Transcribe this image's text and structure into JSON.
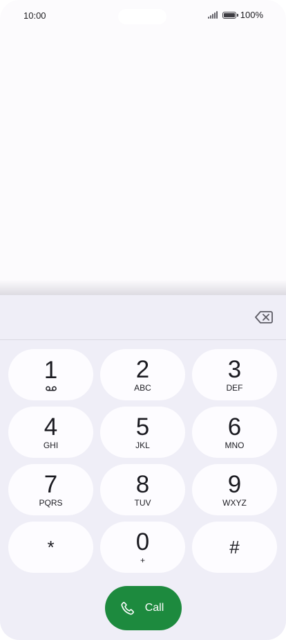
{
  "status_bar": {
    "time": "10:00",
    "battery": "100%"
  },
  "dialpad": {
    "keys": [
      {
        "digit": "1",
        "letters": "",
        "icon": "voicemail-icon"
      },
      {
        "digit": "2",
        "letters": "ABC"
      },
      {
        "digit": "3",
        "letters": "DEF"
      },
      {
        "digit": "4",
        "letters": "GHI"
      },
      {
        "digit": "5",
        "letters": "JKL"
      },
      {
        "digit": "6",
        "letters": "MNO"
      },
      {
        "digit": "7",
        "letters": "PQRS"
      },
      {
        "digit": "8",
        "letters": "TUV"
      },
      {
        "digit": "9",
        "letters": "WXYZ"
      },
      {
        "digit": "*",
        "letters": ""
      },
      {
        "digit": "0",
        "letters": "+"
      },
      {
        "digit": "#",
        "letters": ""
      }
    ],
    "backspace_icon": "backspace-icon",
    "call_label": "Call",
    "call_icon": "phone-icon"
  },
  "colors": {
    "call_green": "#1d8a3e",
    "sheet_bg": "#efeef7",
    "key_bg": "#fdfcff",
    "screen_bg": "#fcfbfd"
  }
}
